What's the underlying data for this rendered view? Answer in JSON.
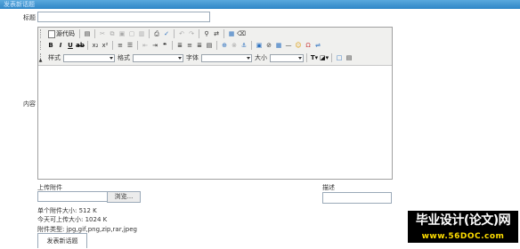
{
  "topbar": {
    "text": "发表新话题"
  },
  "form": {
    "title_label": "标题",
    "content_label": "内容",
    "upload_label": "上传附件",
    "browse_label": "浏览...",
    "description_label": "描述",
    "info": {
      "max_single": "单个附件大小: 512 K",
      "today_limit": "今天可上传大小: 1024 K",
      "types": "附件类型: jpg,gif,png,zip,rar,jpeg"
    },
    "submit_label": "发表新话题"
  },
  "editor": {
    "source_label": "源代码",
    "style_label": "样式",
    "format_label": "格式",
    "font_label": "字体",
    "size_label": "大小",
    "row1_icons": [
      "new-doc-icon",
      "preview-icon",
      "cut-icon",
      "copy-icon",
      "paste-icon",
      "paste-text-icon",
      "paste-word-icon",
      "print-icon",
      "spellcheck-icon",
      "undo-icon",
      "redo-icon",
      "find-icon",
      "replace-icon",
      "select-all-icon",
      "remove-format-icon"
    ],
    "row2_icons": [
      "bold-icon",
      "italic-icon",
      "underline-icon",
      "strike-icon",
      "subscript-icon",
      "superscript-icon",
      "ordered-list-icon",
      "unordered-list-icon",
      "outdent-icon",
      "indent-icon",
      "blockquote-icon",
      "align-left-icon",
      "align-center-icon",
      "align-right-icon",
      "justify-icon",
      "link-icon",
      "unlink-icon",
      "anchor-icon",
      "image-icon",
      "flash-icon",
      "table-icon",
      "horizontal-rule-icon",
      "smiley-icon",
      "special-char-icon",
      "page-break-icon"
    ],
    "row3_icons": [
      "text-color-icon",
      "bg-color-icon",
      "maximize-icon",
      "show-blocks-icon"
    ]
  },
  "watermark": {
    "title": "毕业设计(论文)网",
    "url": "www.56DOC.com"
  }
}
